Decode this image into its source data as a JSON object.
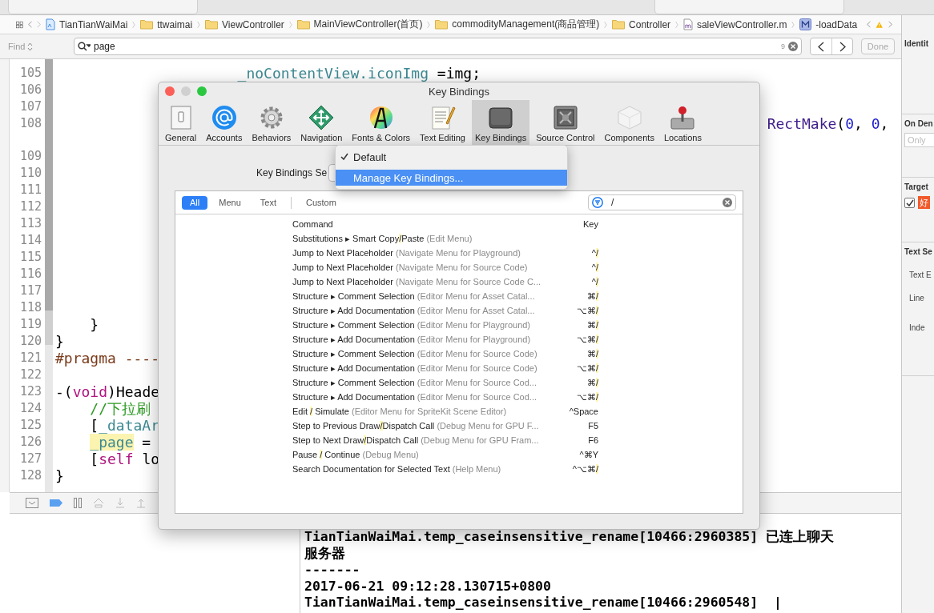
{
  "breadcrumb": {
    "items": [
      {
        "kind": "project",
        "label": "TianTianWaiMai"
      },
      {
        "kind": "folder",
        "label": "ttwaimai"
      },
      {
        "kind": "folder",
        "label": "ViewController"
      },
      {
        "kind": "folder",
        "label": "MainViewController(首页)"
      },
      {
        "kind": "folder",
        "label": "commodityManagement(商品管理)"
      },
      {
        "kind": "folder",
        "label": "Controller"
      },
      {
        "kind": "file",
        "label": "saleViewController.m"
      },
      {
        "kind": "method",
        "label": "-loadData"
      }
    ]
  },
  "find_bar": {
    "mode": "Find",
    "query": "page",
    "match_count": "9",
    "done": "Done"
  },
  "editor": {
    "lines": [
      {
        "number": "105",
        "kind": "continuation",
        "tokens": [
          {
            "text": "_noContentView.iconImg",
            "kind": "property"
          },
          {
            "text": " =img;",
            "kind": "plain"
          }
        ]
      },
      {
        "number": "106"
      },
      {
        "number": "107"
      },
      {
        "number": "108",
        "kind": "overflow",
        "wrapped": true,
        "tokens": [
          {
            "text": "RectMake",
            "kind": "function"
          },
          {
            "text": "(",
            "kind": "plain"
          },
          {
            "text": "0",
            "kind": "number"
          },
          {
            "text": ", ",
            "kind": "plain"
          },
          {
            "text": "0",
            "kind": "number"
          },
          {
            "text": ",",
            "kind": "plain"
          }
        ]
      },
      {
        "number": "109"
      },
      {
        "number": "110"
      },
      {
        "number": "111"
      },
      {
        "number": "112"
      },
      {
        "number": "113"
      },
      {
        "number": "114"
      },
      {
        "number": "115"
      },
      {
        "number": "116"
      },
      {
        "number": "117"
      },
      {
        "number": "118"
      },
      {
        "number": "119",
        "kind": "body",
        "tokens": [
          {
            "text": "}",
            "kind": "plain"
          }
        ]
      },
      {
        "number": "120",
        "kind": "top",
        "tokens": [
          {
            "text": "}",
            "kind": "plain"
          }
        ]
      },
      {
        "number": "121",
        "kind": "top",
        "tokens": [
          {
            "text": "#pragma ----",
            "kind": "directive"
          }
        ]
      },
      {
        "number": "122"
      },
      {
        "number": "123",
        "kind": "top",
        "tokens": [
          {
            "text": "-(",
            "kind": "plain"
          },
          {
            "text": "void",
            "kind": "keyword"
          },
          {
            "text": ")Heade",
            "kind": "plain"
          }
        ]
      },
      {
        "number": "124",
        "kind": "body",
        "tokens": [
          {
            "text": "//下拉刷",
            "kind": "comment"
          }
        ]
      },
      {
        "number": "125",
        "kind": "body",
        "tokens": [
          {
            "text": "[",
            "kind": "plain"
          },
          {
            "text": "_dataAr",
            "kind": "property"
          }
        ]
      },
      {
        "number": "126",
        "kind": "body",
        "tokens": [
          {
            "text": "_page",
            "kind": "match"
          },
          {
            "text": " =",
            "kind": "plain"
          }
        ]
      },
      {
        "number": "127",
        "kind": "body",
        "tokens": [
          {
            "text": "[",
            "kind": "plain"
          },
          {
            "text": "self",
            "kind": "keyword"
          },
          {
            "text": " lo",
            "kind": "plain"
          }
        ]
      },
      {
        "number": "128",
        "kind": "top",
        "tokens": [
          {
            "text": "}",
            "kind": "plain"
          }
        ]
      }
    ]
  },
  "console": {
    "lines": [
      "TianTianWaiMai.temp_caseinsensitive_rename[10466:2960385] 已连上聊天",
      "服务器",
      "-------",
      "2017-06-21 09:12:28.130715+0800",
      "TianTianWaiMai.temp_caseinsensitive_rename[10466:2960548]  |"
    ]
  },
  "inspector": {
    "title": "Identit",
    "on_demand": "On Den",
    "on_demand_field": {
      "placeholder": "Only"
    },
    "target": "Target",
    "target_checked": true,
    "target_app": "好",
    "text_settings": "Text Se",
    "text_encoding": "Text E",
    "line_endings": "Line",
    "indent": "Inde"
  },
  "dialog": {
    "title": "Key Bindings",
    "toolbar": [
      {
        "kind": "general",
        "label": "General",
        "selected": false
      },
      {
        "kind": "accounts",
        "label": "Accounts",
        "selected": false
      },
      {
        "kind": "behaviors",
        "label": "Behaviors",
        "selected": false
      },
      {
        "kind": "navigation",
        "label": "Navigation",
        "selected": false
      },
      {
        "kind": "fonts",
        "label": "Fonts & Colors",
        "selected": false
      },
      {
        "kind": "editing",
        "label": "Text Editing",
        "selected": false
      },
      {
        "kind": "keys",
        "label": "Key Bindings",
        "selected": true
      },
      {
        "kind": "source",
        "label": "Source Control",
        "selected": false
      },
      {
        "kind": "components",
        "label": "Components",
        "selected": false
      },
      {
        "kind": "locations",
        "label": "Locations",
        "selected": false
      }
    ],
    "set_label": "Key Bindings Se",
    "menu": [
      {
        "label": "Default",
        "checked": true,
        "selected": false
      },
      {
        "label": "Manage Key Bindings...",
        "checked": false,
        "selected": true
      }
    ],
    "tabs": [
      {
        "label": "All",
        "selected": true
      },
      {
        "label": "Menu",
        "selected": false
      },
      {
        "label": "Text",
        "selected": false
      },
      {
        "label": "Custom",
        "selected": false
      }
    ],
    "filter": {
      "value": "/"
    },
    "columns": [
      "Command",
      "Key"
    ],
    "rows": [
      {
        "command": [
          {
            "text": "Substitutions ▸ Smart Copy",
            "match": false
          },
          {
            "text": "/",
            "match": true
          },
          {
            "text": "Paste",
            "match": false
          }
        ],
        "context": "(Edit Menu)"
      },
      {
        "command": [
          {
            "text": "Jump to Next Placeholder",
            "match": false
          }
        ],
        "context": "(Navigate Menu for Playground)",
        "key": [
          {
            "text": "^",
            "match": false
          },
          {
            "text": "/",
            "match": true
          }
        ]
      },
      {
        "command": [
          {
            "text": "Jump to Next Placeholder",
            "match": false
          }
        ],
        "context": "(Navigate Menu for Source Code)",
        "key": [
          {
            "text": "^",
            "match": false
          },
          {
            "text": "/",
            "match": true
          }
        ]
      },
      {
        "command": [
          {
            "text": "Jump to Next Placeholder",
            "match": false
          }
        ],
        "context": "(Navigate Menu for Source Code C...",
        "key": [
          {
            "text": "^",
            "match": false
          },
          {
            "text": "/",
            "match": true
          }
        ]
      },
      {
        "command": [
          {
            "text": "Structure ▸ Comment Selection",
            "match": false
          }
        ],
        "context": "(Editor Menu for Asset Catal...",
        "key": [
          {
            "text": "⌘",
            "match": false
          },
          {
            "text": "/",
            "match": true
          }
        ]
      },
      {
        "command": [
          {
            "text": "Structure ▸ Add Documentation",
            "match": false
          }
        ],
        "context": "(Editor Menu for Asset Catal...",
        "key": [
          {
            "text": "⌥⌘",
            "match": false
          },
          {
            "text": "/",
            "match": true
          }
        ]
      },
      {
        "command": [
          {
            "text": "Structure ▸ Comment Selection",
            "match": false
          }
        ],
        "context": "(Editor Menu for Playground)",
        "key": [
          {
            "text": "⌘",
            "match": false
          },
          {
            "text": "/",
            "match": true
          }
        ]
      },
      {
        "command": [
          {
            "text": "Structure ▸ Add Documentation",
            "match": false
          }
        ],
        "context": "(Editor Menu for Playground)",
        "key": [
          {
            "text": "⌥⌘",
            "match": false
          },
          {
            "text": "/",
            "match": true
          }
        ]
      },
      {
        "command": [
          {
            "text": "Structure ▸ Comment Selection",
            "match": false
          }
        ],
        "context": "(Editor Menu for Source Code)",
        "key": [
          {
            "text": "⌘",
            "match": false
          },
          {
            "text": "/",
            "match": true
          }
        ]
      },
      {
        "command": [
          {
            "text": "Structure ▸ Add Documentation",
            "match": false
          }
        ],
        "context": "(Editor Menu for Source Code)",
        "key": [
          {
            "text": "⌥⌘",
            "match": false
          },
          {
            "text": "/",
            "match": true
          }
        ]
      },
      {
        "command": [
          {
            "text": "Structure ▸ Comment Selection",
            "match": false
          }
        ],
        "context": "(Editor Menu for Source Cod...",
        "key": [
          {
            "text": "⌘",
            "match": false
          },
          {
            "text": "/",
            "match": true
          }
        ]
      },
      {
        "command": [
          {
            "text": "Structure ▸ Add Documentation",
            "match": false
          }
        ],
        "context": "(Editor Menu for Source Cod...",
        "key": [
          {
            "text": "⌥⌘",
            "match": false
          },
          {
            "text": "/",
            "match": true
          }
        ]
      },
      {
        "command": [
          {
            "text": "Edit ",
            "match": false
          },
          {
            "text": "/",
            "match": true
          },
          {
            "text": " Simulate",
            "match": false
          }
        ],
        "context": "(Editor Menu for SpriteKit Scene Editor)",
        "key": [
          {
            "text": "^Space",
            "match": false
          }
        ]
      },
      {
        "command": [
          {
            "text": "Step to Previous Draw",
            "match": false
          },
          {
            "text": "/",
            "match": true
          },
          {
            "text": "Dispatch Call",
            "match": false
          }
        ],
        "context": "(Debug Menu for GPU F...",
        "key": [
          {
            "text": "F5",
            "match": false
          }
        ]
      },
      {
        "command": [
          {
            "text": "Step to Next Draw",
            "match": false
          },
          {
            "text": "/",
            "match": true
          },
          {
            "text": "Dispatch Call",
            "match": false
          }
        ],
        "context": "(Debug Menu for GPU Fram...",
        "key": [
          {
            "text": "F6",
            "match": false
          }
        ]
      },
      {
        "command": [
          {
            "text": "Pause ",
            "match": false
          },
          {
            "text": "/",
            "match": true
          },
          {
            "text": " Continue",
            "match": false
          }
        ],
        "context": "(Debug Menu)",
        "key": [
          {
            "text": "^⌘Y",
            "match": false
          }
        ]
      },
      {
        "command": [
          {
            "text": "Search Documentation for Selected Text",
            "match": false
          }
        ],
        "context": "(Help Menu)",
        "key": [
          {
            "text": "^⌥⌘",
            "match": false
          },
          {
            "text": "/",
            "match": true
          }
        ]
      }
    ]
  }
}
